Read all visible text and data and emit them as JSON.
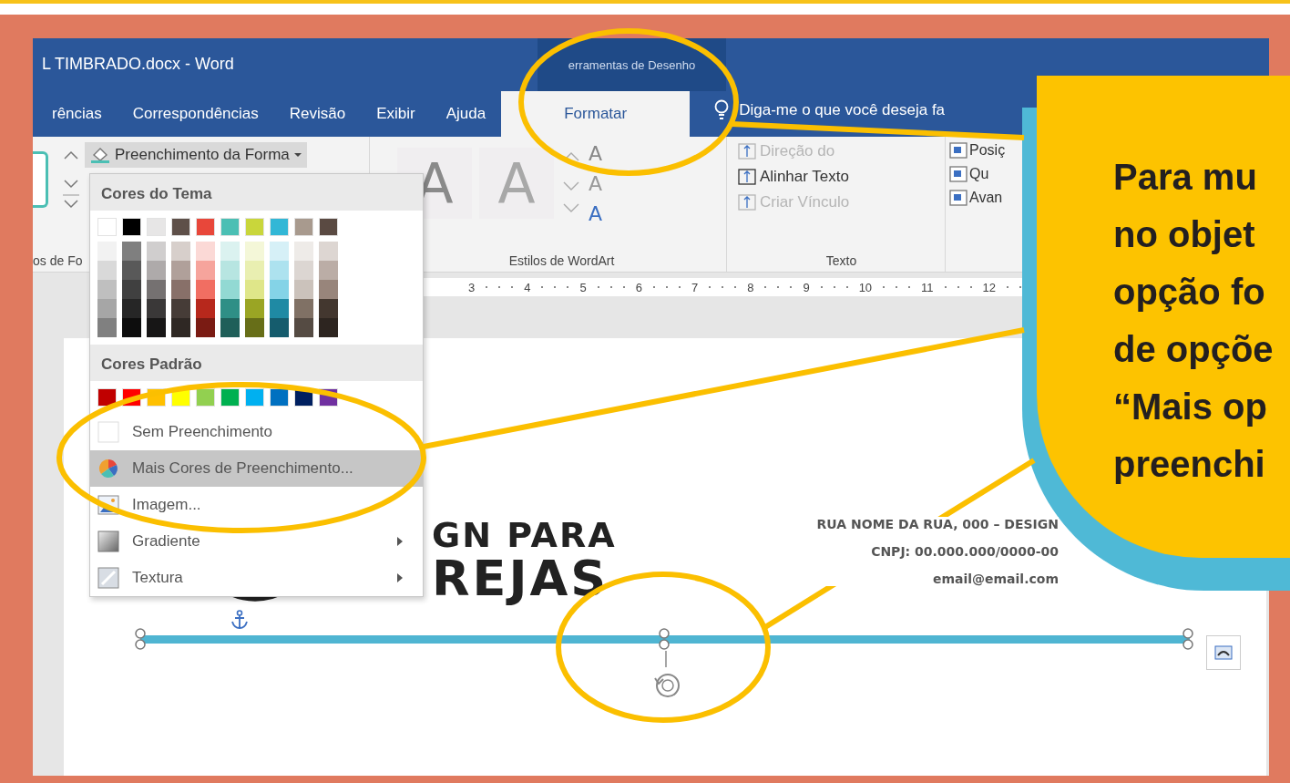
{
  "window": {
    "title": "L TIMBRADO.docx  -  Word",
    "context_group": "erramentas de Desenho"
  },
  "tabs": [
    {
      "label": "rências",
      "selected": false
    },
    {
      "label": "Correspondências",
      "selected": false
    },
    {
      "label": "Revisão",
      "selected": false
    },
    {
      "label": "Exibir",
      "selected": false
    },
    {
      "label": "Ajuda",
      "selected": false
    },
    {
      "label": "Formatar",
      "selected": true
    }
  ],
  "tell_me": {
    "placeholder": "Diga-me o que você deseja fa"
  },
  "ribbon": {
    "shape_fill": "Preenchimento da Forma",
    "group_labels": [
      "os de Fo",
      "Estilos de WordArt",
      "Texto"
    ],
    "wordart_samples": [
      "A",
      "A"
    ],
    "wordart_tools": [
      "A",
      "A",
      "A"
    ],
    "text_commands": [
      {
        "label": "Direção do",
        "disabled": true
      },
      {
        "label": "Alinhar Texto",
        "disabled": false
      },
      {
        "label": "Criar Vínculo",
        "disabled": true
      }
    ],
    "arrange_commands": [
      "Posiç",
      "Qu",
      "Avan"
    ]
  },
  "ruler": [
    "3",
    "4",
    "5",
    "6",
    "7",
    "8",
    "9",
    "10",
    "11",
    "12"
  ],
  "fill_menu": {
    "theme_title": "Cores do Tema",
    "standard_title": "Cores Padrão",
    "theme_colors": [
      {
        "color": "#ffffff",
        "shades": [
          {
            "color": "#f2f2f2"
          },
          {
            "color": "#d9d9d9"
          },
          {
            "color": "#bfbfbf"
          },
          {
            "color": "#a6a6a6"
          },
          {
            "color": "#808080"
          }
        ]
      },
      {
        "color": "#000000",
        "shades": [
          {
            "color": "#7f7f7f"
          },
          {
            "color": "#595959"
          },
          {
            "color": "#404040"
          },
          {
            "color": "#262626"
          },
          {
            "color": "#0d0d0d"
          }
        ]
      },
      {
        "color": "#e7e6e6",
        "shades": [
          {
            "color": "#d0cece"
          },
          {
            "color": "#aeaaaa"
          },
          {
            "color": "#757171"
          },
          {
            "color": "#3a3838"
          },
          {
            "color": "#171616"
          }
        ]
      },
      {
        "color": "#5e5049",
        "shades": [
          {
            "color": "#d7cfcb"
          },
          {
            "color": "#b0a09a"
          },
          {
            "color": "#887069"
          },
          {
            "color": "#463c37"
          },
          {
            "color": "#2f2824"
          }
        ]
      },
      {
        "color": "#e8473a",
        "shades": [
          {
            "color": "#fbd9d6"
          },
          {
            "color": "#f6a49c"
          },
          {
            "color": "#f16e62"
          },
          {
            "color": "#b7281c"
          },
          {
            "color": "#7a1b13"
          }
        ]
      },
      {
        "color": "#4bbfb4",
        "shades": [
          {
            "color": "#dbf2f0"
          },
          {
            "color": "#b7e5e1"
          },
          {
            "color": "#92d9d3"
          },
          {
            "color": "#2f8f86"
          },
          {
            "color": "#1f5f59"
          }
        ]
      },
      {
        "color": "#c9d63b",
        "shades": [
          {
            "color": "#f4f7d8"
          },
          {
            "color": "#e9efb1"
          },
          {
            "color": "#dfe689"
          },
          {
            "color": "#9aa524"
          },
          {
            "color": "#676e18"
          }
        ]
      },
      {
        "color": "#32b7d6",
        "shades": [
          {
            "color": "#d6f0f7"
          },
          {
            "color": "#ade2ef"
          },
          {
            "color": "#84d3e7"
          },
          {
            "color": "#1f8aa4"
          },
          {
            "color": "#155c6d"
          }
        ]
      },
      {
        "color": "#a89a8e",
        "shades": [
          {
            "color": "#eeebe8"
          },
          {
            "color": "#dcd6d2"
          },
          {
            "color": "#cbc2bb"
          },
          {
            "color": "#807165"
          },
          {
            "color": "#554b43"
          }
        ]
      },
      {
        "color": "#5a4a42",
        "shades": [
          {
            "color": "#ddd6d2"
          },
          {
            "color": "#bbada6"
          },
          {
            "color": "#98857b"
          },
          {
            "color": "#43372f"
          },
          {
            "color": "#2d2520"
          }
        ]
      }
    ],
    "standard_colors": [
      {
        "color": "#c00000"
      },
      {
        "color": "#ff0000"
      },
      {
        "color": "#ffc000"
      },
      {
        "color": "#ffff00"
      },
      {
        "color": "#92d050"
      },
      {
        "color": "#00b050"
      },
      {
        "color": "#00b0f0"
      },
      {
        "color": "#0070c0"
      },
      {
        "color": "#002060"
      },
      {
        "color": "#7030a0"
      }
    ],
    "items": [
      {
        "label": "Sem Preenchimento",
        "kind": "none",
        "selected": false,
        "submenu": false
      },
      {
        "label": "Mais Cores de Preenchimento...",
        "kind": "palette",
        "selected": true,
        "submenu": false
      },
      {
        "label": "Imagem...",
        "kind": "image",
        "selected": false,
        "submenu": false
      },
      {
        "label": "Gradiente",
        "kind": "gradient",
        "selected": false,
        "submenu": true
      },
      {
        "label": "Textura",
        "kind": "texture",
        "selected": false,
        "submenu": true
      }
    ]
  },
  "document": {
    "logo_line_1": "GN PARA",
    "logo_line_2": "REJAS",
    "address": [
      "RUA NOME DA RUA, 000 – DESIGN",
      "CNPJ: 00.000.000/0000-00",
      "email@email.com"
    ]
  },
  "callout": {
    "text": "Para mu\nno objet\nopção fo\nde opçõe\n“Mais op\npreenchi"
  }
}
